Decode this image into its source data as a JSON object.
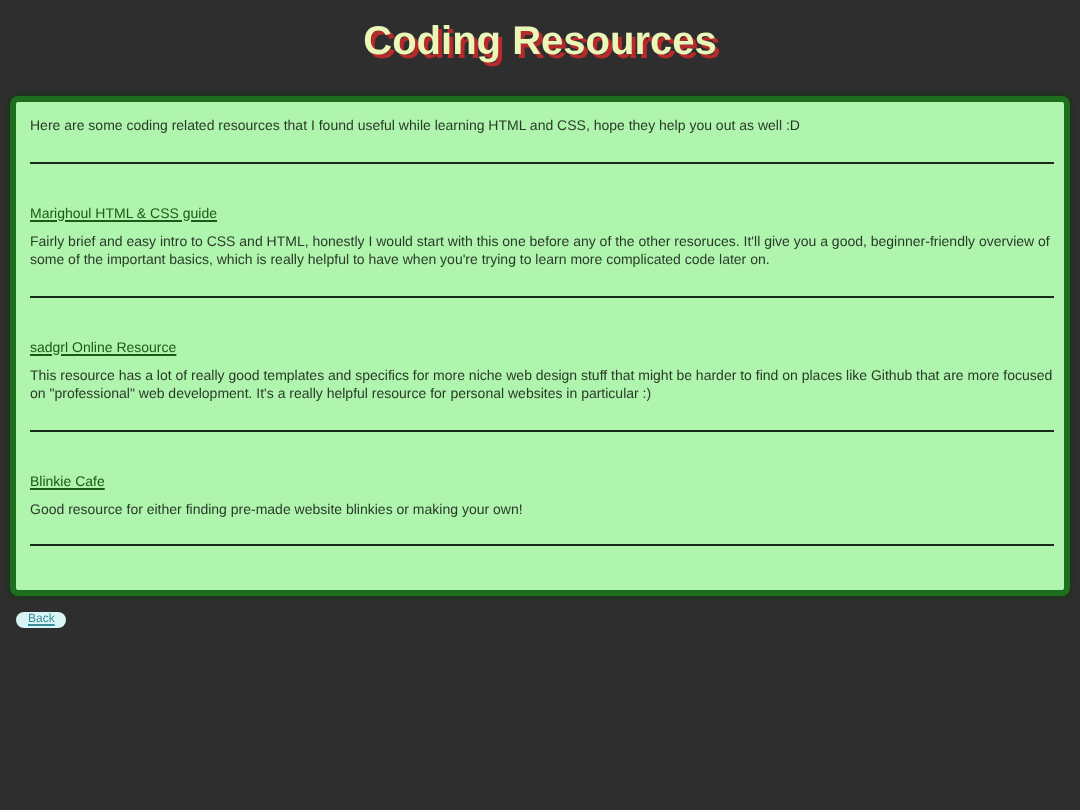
{
  "title": "Coding Resources",
  "intro": "Here are some coding related resources that I found useful while learning HTML and CSS, hope they help you out as well :D",
  "resources": [
    {
      "name": "Marighoul HTML & CSS guide",
      "description": "Fairly brief and easy intro to CSS and HTML, honestly I would start with this one before any of the other resoruces. It'll give you a good, beginner-friendly overview of some of the important basics, which is really helpful to have when you're trying to learn more complicated code later on."
    },
    {
      "name": "sadgrl Online Resource",
      "description": "This resource has a lot of really good templates and specifics for more niche web design stuff that might be harder to find on places like Github that are more focused on \"professional\" web development. It's a really helpful resource for personal websites in particular :)"
    },
    {
      "name": "Blinkie Cafe",
      "description": "Good resource for either finding pre-made website blinkies or making your own!"
    }
  ],
  "back_button": "Back"
}
